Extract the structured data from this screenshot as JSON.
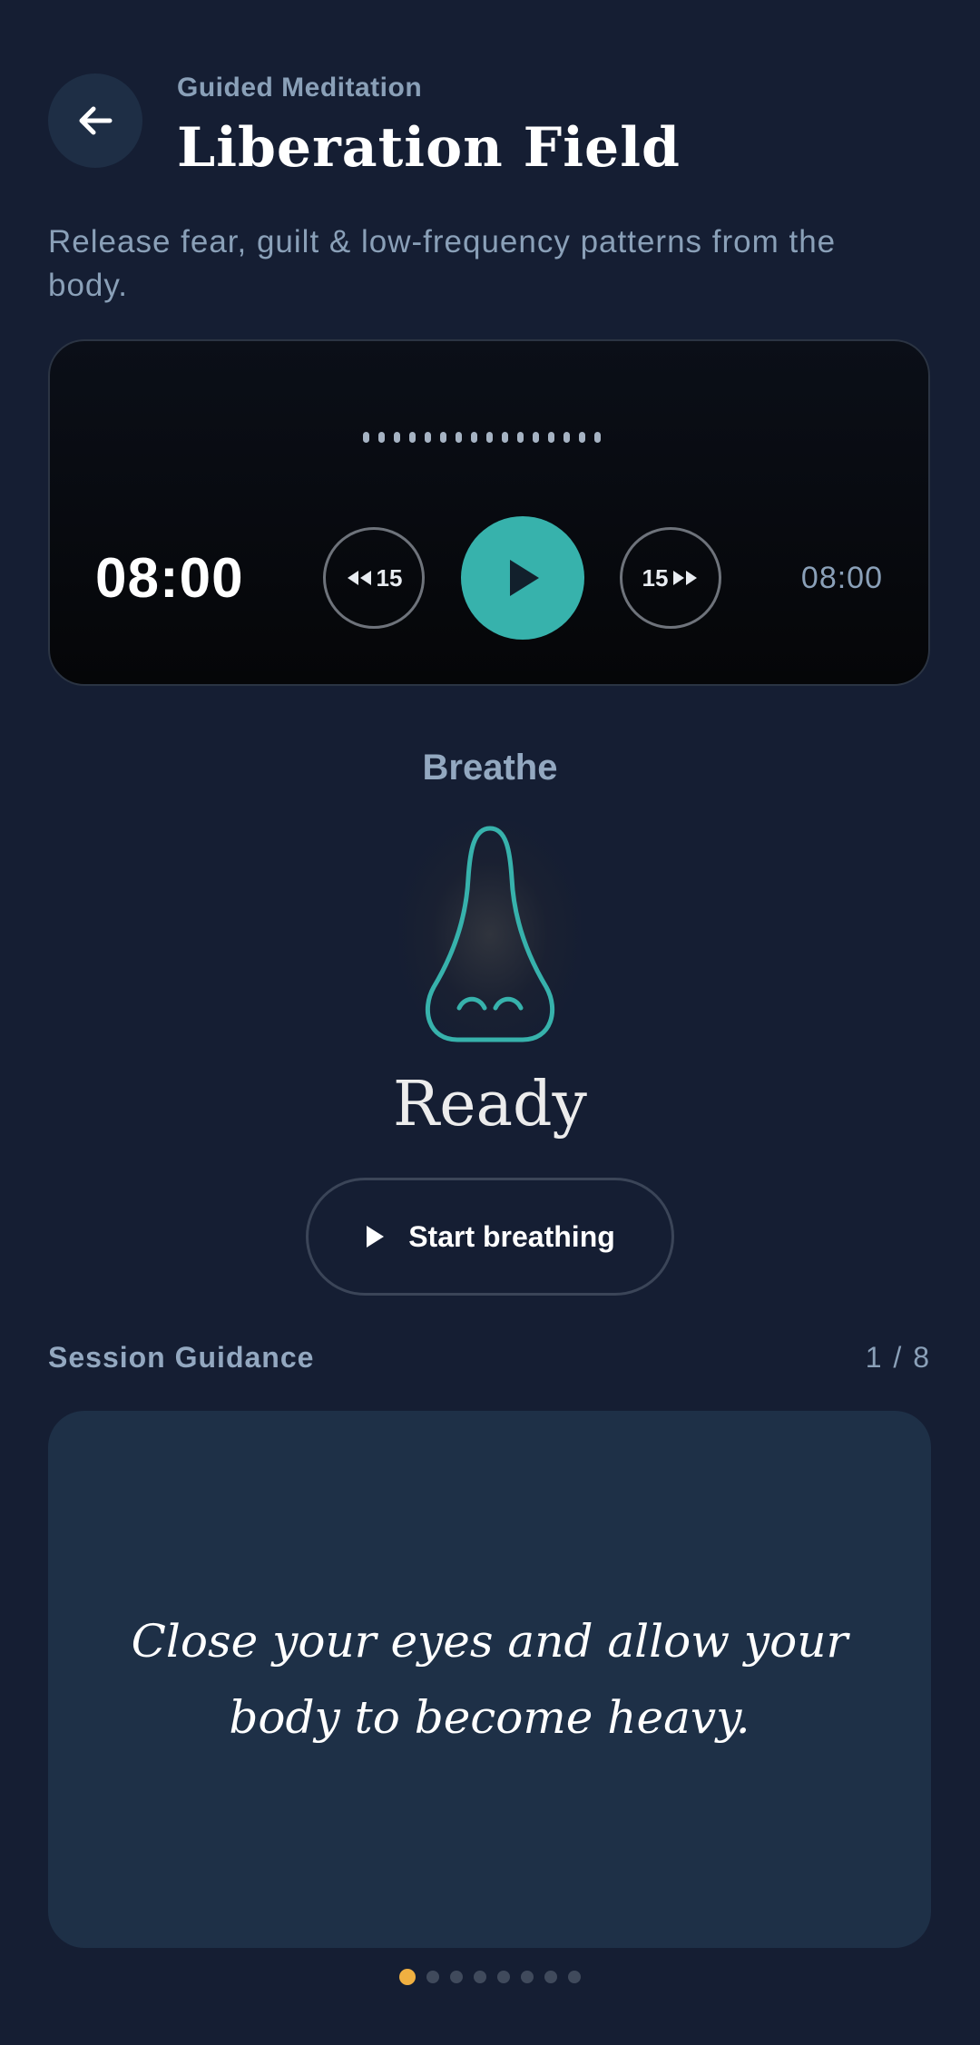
{
  "header": {
    "eyebrow": "Guided Meditation",
    "title": "Liberation Field",
    "subtitle": "Release fear, guilt & low-frequency patterns from the body."
  },
  "player": {
    "elapsed": "08:00",
    "total": "08:00",
    "skip_back_label": "15",
    "skip_forward_label": "15",
    "waveform_bars": 16,
    "accent_color": "#37b2ac"
  },
  "breathing": {
    "label": "Breathe",
    "status": "Ready",
    "start_label": "Start breathing"
  },
  "guidance": {
    "title": "Session Guidance",
    "counter": "1 / 8",
    "text": "Close your eyes and allow your body to become heavy.",
    "total_pages": 8,
    "active_page": 1,
    "active_color": "#f0b041"
  },
  "icons": {
    "back": "arrow-left-icon",
    "play": "play-icon",
    "rewind": "rewind-icon",
    "fast_forward": "fast-forward-icon",
    "nose": "nose-icon"
  }
}
